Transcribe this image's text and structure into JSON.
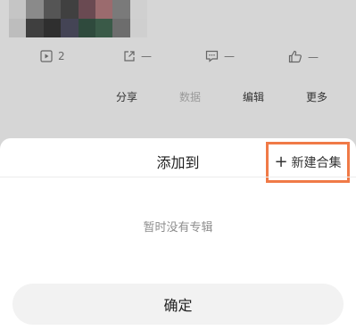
{
  "stats": {
    "plays": "2",
    "shares": "—",
    "comments": "—",
    "likes": "—"
  },
  "actions": {
    "share": "分享",
    "data": "数据",
    "edit": "编辑",
    "more": "更多"
  },
  "sheet": {
    "title": "添加到",
    "new_collection": "新建合集",
    "empty_message": "暂时没有专辑",
    "confirm": "确定"
  },
  "colors": {
    "highlight_border": "#f07a47",
    "sheet_bg": "#ffffff",
    "backdrop": "#d6d6d6",
    "button_bg": "#f2f2f2"
  },
  "icons": {
    "plays": "play-icon",
    "shares": "share-icon",
    "comments": "comment-icon",
    "likes": "thumbs-up-icon",
    "new_collection": "plus-icon"
  }
}
